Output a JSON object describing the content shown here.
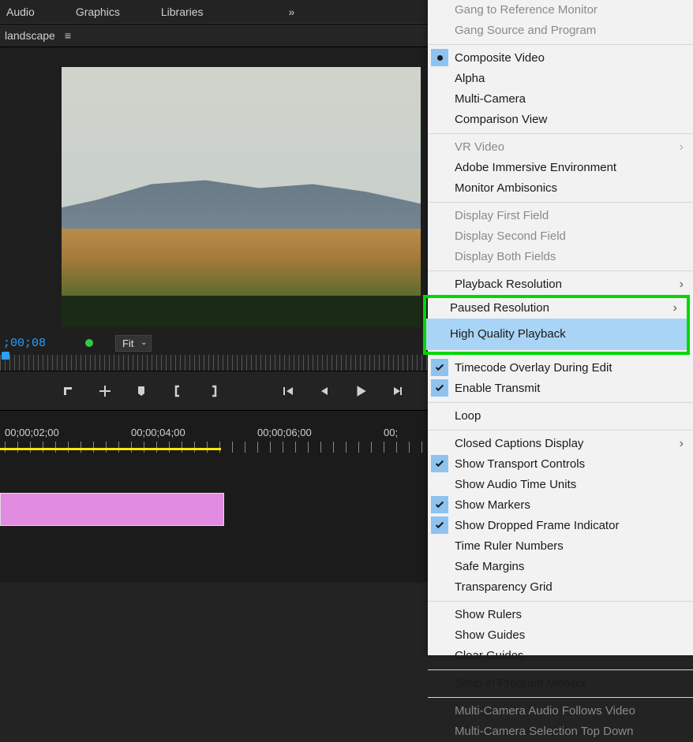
{
  "tabs": {
    "audio": "Audio",
    "graphics": "Graphics",
    "libraries": "Libraries"
  },
  "sequence": {
    "name": "landscape"
  },
  "timecode": ";00;08",
  "fit_label": "Fit",
  "timeline_labels": [
    "00;00;02;00",
    "00;00;04;00",
    "00;00;06;00",
    "00;"
  ],
  "menu": {
    "gang_ref": "Gang to Reference Monitor",
    "gang_src": "Gang Source and Program",
    "composite": "Composite Video",
    "alpha": "Alpha",
    "multicam": "Multi-Camera",
    "comparison": "Comparison View",
    "vr": "VR Video",
    "immersive": "Adobe Immersive Environment",
    "ambisonics": "Monitor Ambisonics",
    "first_field": "Display First Field",
    "second_field": "Display Second Field",
    "both_fields": "Display Both Fields",
    "playback_res": "Playback Resolution",
    "paused_res": "Paused Resolution",
    "hq_playback": "High Quality Playback",
    "tc_overlay": "Timecode Overlay During Edit",
    "enable_transmit": "Enable Transmit",
    "loop": "Loop",
    "cc_display": "Closed Captions Display",
    "show_transport": "Show Transport Controls",
    "audio_units": "Show Audio Time Units",
    "show_markers": "Show Markers",
    "dropped_frame": "Show Dropped Frame Indicator",
    "time_ruler": "Time Ruler Numbers",
    "safe_margins": "Safe Margins",
    "transparency": "Transparency Grid",
    "show_rulers": "Show Rulers",
    "show_guides": "Show Guides",
    "clear_guides": "Clear Guides",
    "snap_program": "Snap in Program Monitor",
    "mc_audio": "Multi-Camera Audio Follows Video",
    "mc_topdown": "Multi-Camera Selection Top Down"
  }
}
